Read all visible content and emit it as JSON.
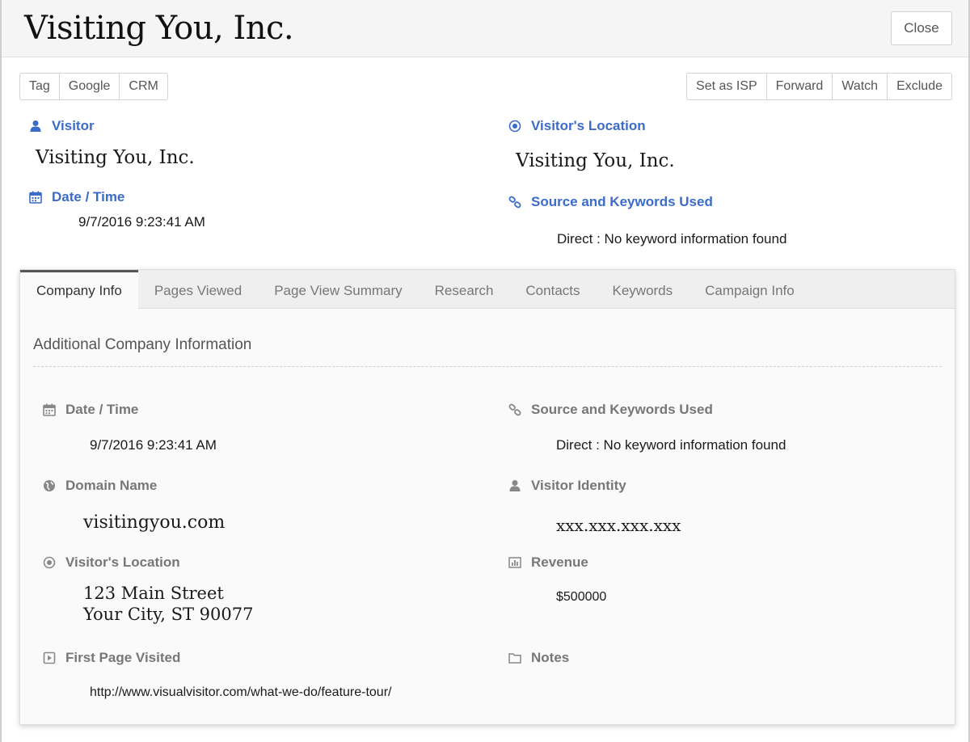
{
  "header": {
    "title": "Visiting You, Inc.",
    "close_label": "Close"
  },
  "toolbar": {
    "left": [
      "Tag",
      "Google",
      "CRM"
    ],
    "right": [
      "Set as ISP",
      "Forward",
      "Watch",
      "Exclude"
    ]
  },
  "summary": {
    "visitor_label": "Visitor",
    "visitor_value": "Visiting You, Inc.",
    "datetime_label": "Date / Time",
    "datetime_value": "9/7/2016 9:23:41 AM",
    "location_label": "Visitor's Location",
    "location_value": "Visiting You, Inc.",
    "source_label": "Source and Keywords Used",
    "source_value": "Direct : No keyword information found"
  },
  "tabs": [
    "Company Info",
    "Pages Viewed",
    "Page View Summary",
    "Research",
    "Contacts",
    "Keywords",
    "Campaign Info"
  ],
  "active_tab": "Company Info",
  "company_info": {
    "section_title": "Additional Company Information",
    "datetime_label": "Date / Time",
    "datetime_value": "9/7/2016 9:23:41 AM",
    "source_label": "Source and Keywords Used",
    "source_value": "Direct : No keyword information found",
    "domain_label": "Domain Name",
    "domain_value": "visitingyou.com",
    "identity_label": "Visitor Identity",
    "identity_value": "xxx.xxx.xxx.xxx",
    "location_label": "Visitor's Location",
    "address_line1": "123 Main Street",
    "address_line2": "Your City, ST 90077",
    "revenue_label": "Revenue",
    "revenue_value": "$500000",
    "first_page_label": "First Page Visited",
    "first_page_value": "http://www.visualvisitor.com/what-we-do/feature-tour/",
    "notes_label": "Notes"
  },
  "colors": {
    "accent": "#3b6cc9",
    "muted_label": "#777777"
  }
}
